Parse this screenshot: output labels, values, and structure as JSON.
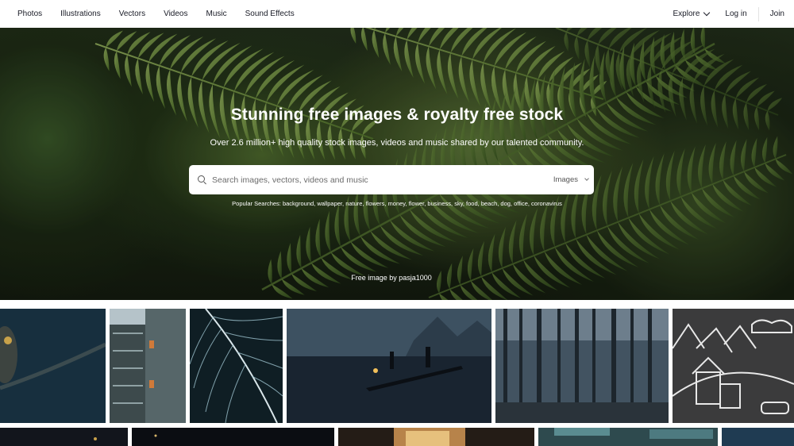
{
  "header": {
    "nav": [
      "Photos",
      "Illustrations",
      "Vectors",
      "Videos",
      "Music",
      "Sound Effects"
    ],
    "explore_label": "Explore",
    "login_label": "Log in",
    "join_label": "Join"
  },
  "hero": {
    "title": "Stunning free images & royalty free stock",
    "subtitle": "Over 2.6 million+ high quality stock images, videos and music shared by our talented community.",
    "search_placeholder": "Search images, vectors, videos and music",
    "search_type": "Images",
    "popular_label": "Popular Searches:",
    "popular_terms": "background, wallpaper, nature, flowers, money, flower, business, sky, food, beach, dog, office, coronavirus",
    "credit": "Free image by pasja1000"
  },
  "colors": {
    "brand_text": "#191b26",
    "hero_green": "#4e6a2e"
  },
  "gallery": {
    "row1": [
      "owl-photo",
      "building-photo",
      "feather-photo",
      "fisherman-photo",
      "forest-photo",
      "chalk-drawing"
    ],
    "row2": [
      "night-photo-1",
      "night-photo-2",
      "market-photo",
      "boats-photo",
      "sky-photo"
    ]
  }
}
